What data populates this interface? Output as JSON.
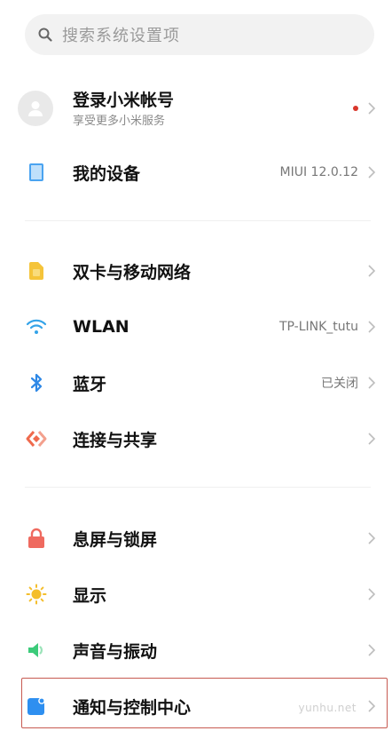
{
  "search": {
    "placeholder": "搜索系统设置项",
    "icon": "search-icon"
  },
  "account": {
    "title": "登录小米帐号",
    "subtitle": "享受更多小米服务",
    "badge_color": "#d9362b"
  },
  "rows": [
    {
      "label": "我的设备",
      "value": "MIUI 12.0.12",
      "icon": "device-icon",
      "color": "#4aa3f0"
    },
    {
      "label": "双卡与移动网络",
      "value": "",
      "icon": "sim-card-icon",
      "color": "#f5c43a"
    },
    {
      "label": "WLAN",
      "value": "TP-LINK_tutu",
      "icon": "wifi-icon",
      "color": "#34a3e8"
    },
    {
      "label": "蓝牙",
      "value": "已关闭",
      "icon": "bluetooth-icon",
      "color": "#2e88e6"
    },
    {
      "label": "连接与共享",
      "value": "",
      "icon": "share-icon",
      "color": "#ef6a4d"
    },
    {
      "label": "息屏与锁屏",
      "value": "",
      "icon": "lock-icon",
      "color": "#ef6a5f"
    },
    {
      "label": "显示",
      "value": "",
      "icon": "sun-icon",
      "color": "#f4be2c"
    },
    {
      "label": "声音与振动",
      "value": "",
      "icon": "speaker-icon",
      "color": "#3ccb7a"
    },
    {
      "label": "通知与控制中心",
      "value": "",
      "icon": "notification-icon",
      "color": "#2e8ff0"
    }
  ],
  "watermark": "yunhu.net"
}
